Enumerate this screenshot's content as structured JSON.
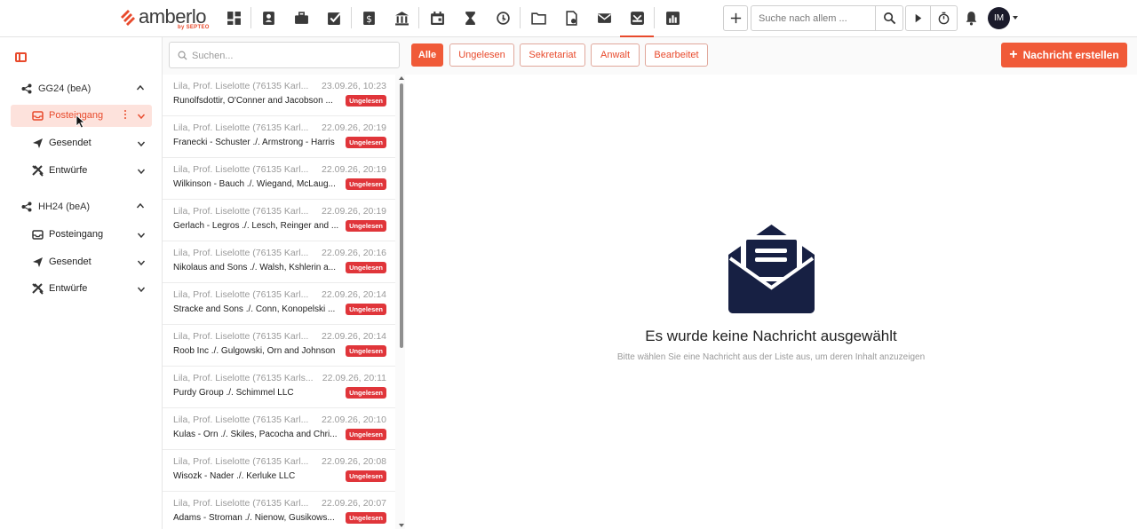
{
  "app": {
    "logo_text": "amberlo",
    "logo_sub": "by SEPTEO"
  },
  "topbar": {
    "nav_icons": [
      "dashboard-icon",
      "contacts-icon",
      "briefcase-icon",
      "tasks-icon",
      "billing-icon",
      "bank-icon",
      "calendar-icon",
      "hourglass-icon",
      "history-icon",
      "folder-icon",
      "documents-icon",
      "mail-icon",
      "bea-inbox-icon",
      "reports-icon"
    ],
    "active_icon": "bea-inbox-icon",
    "search_placeholder": "Suche nach allem ...",
    "avatar_initials": "IM"
  },
  "sidebar": {
    "accounts": [
      {
        "name": "GG24 (beA)",
        "folders": [
          {
            "label": "Posteingang",
            "icon": "inbox-icon",
            "active": true
          },
          {
            "label": "Gesendet",
            "icon": "send-icon",
            "active": false
          },
          {
            "label": "Entwürfe",
            "icon": "drafts-icon",
            "active": false
          }
        ]
      },
      {
        "name": "HH24 (beA)",
        "folders": [
          {
            "label": "Posteingang",
            "icon": "inbox-icon",
            "active": false
          },
          {
            "label": "Gesendet",
            "icon": "send-icon",
            "active": false
          },
          {
            "label": "Entwürfe",
            "icon": "drafts-icon",
            "active": false
          }
        ]
      }
    ]
  },
  "list": {
    "search_placeholder": "Suchen...",
    "messages": [
      {
        "from": "Lila, Prof. Liselotte (76135 Karl...",
        "date": "23.09.26, 10:23",
        "subject": "Runolfsdottir, O'Conner and Jacobson ...",
        "badge": "Ungelesen"
      },
      {
        "from": "Lila, Prof. Liselotte (76135 Karl...",
        "date": "22.09.26, 20:19",
        "subject": "Franecki - Schuster ./. Armstrong - Harris",
        "badge": "Ungelesen"
      },
      {
        "from": "Lila, Prof. Liselotte (76135 Karl...",
        "date": "22.09.26, 20:19",
        "subject": "Wilkinson - Bauch ./. Wiegand, McLaug...",
        "badge": "Ungelesen"
      },
      {
        "from": "Lila, Prof. Liselotte (76135 Karl...",
        "date": "22.09.26, 20:19",
        "subject": "Gerlach - Legros ./. Lesch, Reinger and ...",
        "badge": "Ungelesen"
      },
      {
        "from": "Lila, Prof. Liselotte (76135 Karl...",
        "date": "22.09.26, 20:16",
        "subject": "Nikolaus and Sons ./. Walsh, Kshlerin a...",
        "badge": "Ungelesen"
      },
      {
        "from": "Lila, Prof. Liselotte (76135 Karl...",
        "date": "22.09.26, 20:14",
        "subject": "Stracke and Sons ./. Conn, Konopelski ...",
        "badge": "Ungelesen"
      },
      {
        "from": "Lila, Prof. Liselotte (76135 Karl...",
        "date": "22.09.26, 20:14",
        "subject": "Roob Inc ./. Gulgowski, Orn and Johnson",
        "badge": "Ungelesen"
      },
      {
        "from": "Lila, Prof. Liselotte (76135 Karls...",
        "date": "22.09.26, 20:11",
        "subject": "Purdy Group ./. Schimmel LLC",
        "badge": "Ungelesen"
      },
      {
        "from": "Lila, Prof. Liselotte (76135 Karl...",
        "date": "22.09.26, 20:10",
        "subject": "Kulas - Orn ./. Skiles, Pacocha and Chri...",
        "badge": "Ungelesen"
      },
      {
        "from": "Lila, Prof. Liselotte (76135 Karl...",
        "date": "22.09.26, 20:08",
        "subject": "Wisozk - Nader ./. Kerluke LLC",
        "badge": "Ungelesen"
      },
      {
        "from": "Lila, Prof. Liselotte (76135 Karl...",
        "date": "22.09.26, 20:07",
        "subject": "Adams - Stroman ./. Nienow, Gusikows...",
        "badge": "Ungelesen"
      }
    ]
  },
  "filters": [
    {
      "label": "Alle",
      "active": true
    },
    {
      "label": "Ungelesen",
      "active": false
    },
    {
      "label": "Sekretariat",
      "active": false
    },
    {
      "label": "Anwalt",
      "active": false
    },
    {
      "label": "Bearbeitet",
      "active": false
    }
  ],
  "create_button": "Nachricht erstellen",
  "empty_state": {
    "title": "Es wurde keine Nachricht ausgewählt",
    "subtitle": "Bitte wählen Sie eine Nachricht aus der Liste aus, um deren Inhalt anzuzeigen"
  },
  "colors": {
    "accent": "#f05a38",
    "badge": "#e0353a",
    "navy": "#172043"
  }
}
